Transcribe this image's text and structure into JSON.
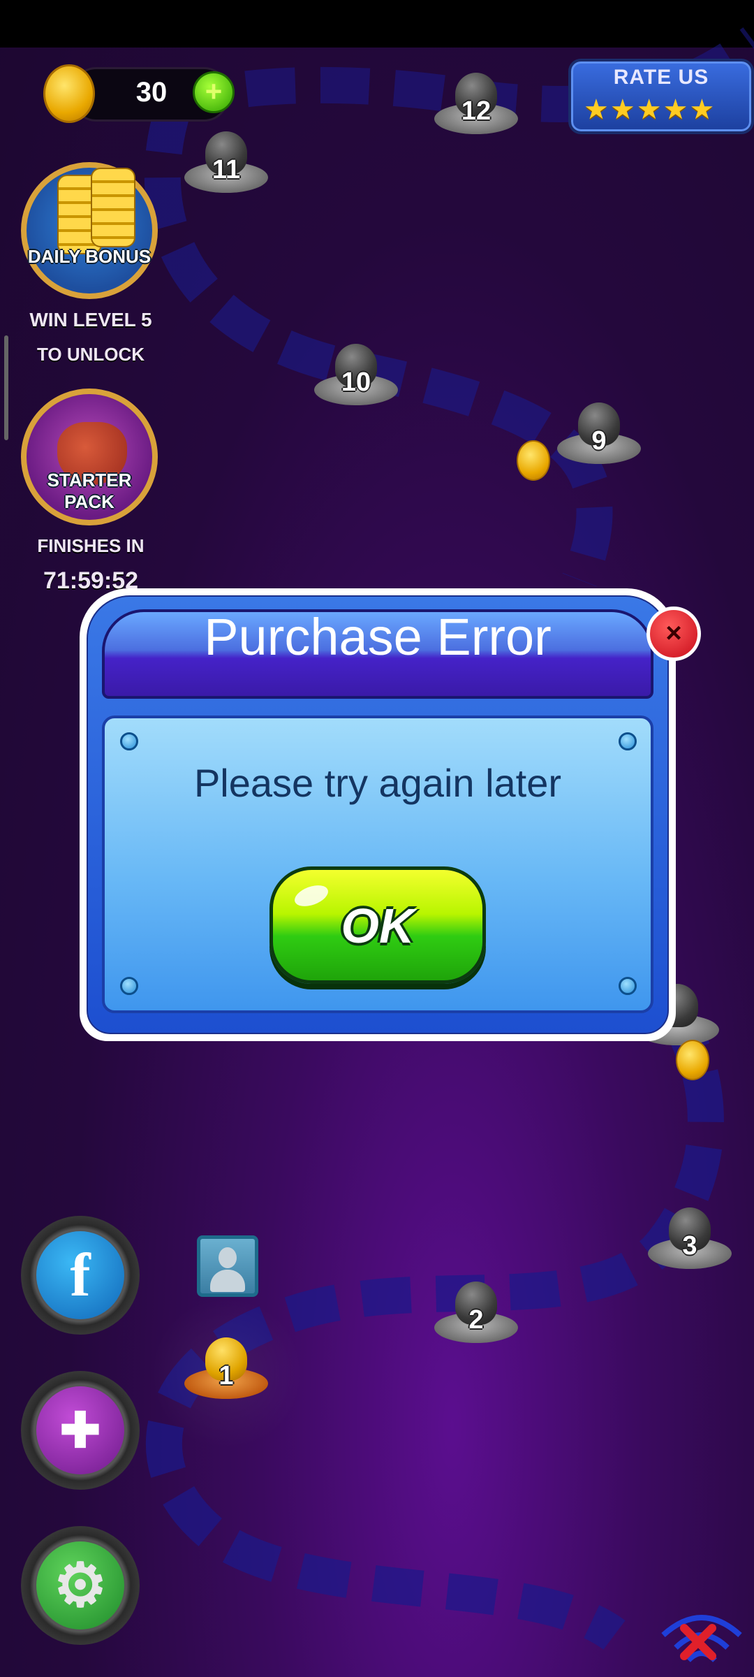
{
  "hud": {
    "coin_count": "30",
    "plus_symbol": "+",
    "rate_us_label": "RATE US",
    "rate_us_stars": "★★★★★"
  },
  "sidebar": {
    "daily_bonus_label": "DAILY BONUS",
    "daily_bonus_status_line1": "WIN LEVEL 5",
    "daily_bonus_status_line2": "TO UNLOCK",
    "starter_pack_label": "STARTER PACK",
    "starter_pack_status_label": "FINISHES IN",
    "starter_pack_timer": "71:59:52"
  },
  "levels": [
    "1",
    "2",
    "3",
    "9",
    "10",
    "11",
    "12"
  ],
  "bottom_buttons": {
    "facebook_glyph": "f",
    "games_glyph": "✚",
    "settings_glyph": "⚙"
  },
  "dialog": {
    "title": "Purchase Error",
    "message": "Please try again later",
    "ok_label": "OK",
    "close_glyph": "×"
  },
  "colors": {
    "background": "#24083c",
    "dialog_frame": "#1d4fd0",
    "ok_green": "#2fcc12",
    "close_red": "#c80c1a"
  }
}
